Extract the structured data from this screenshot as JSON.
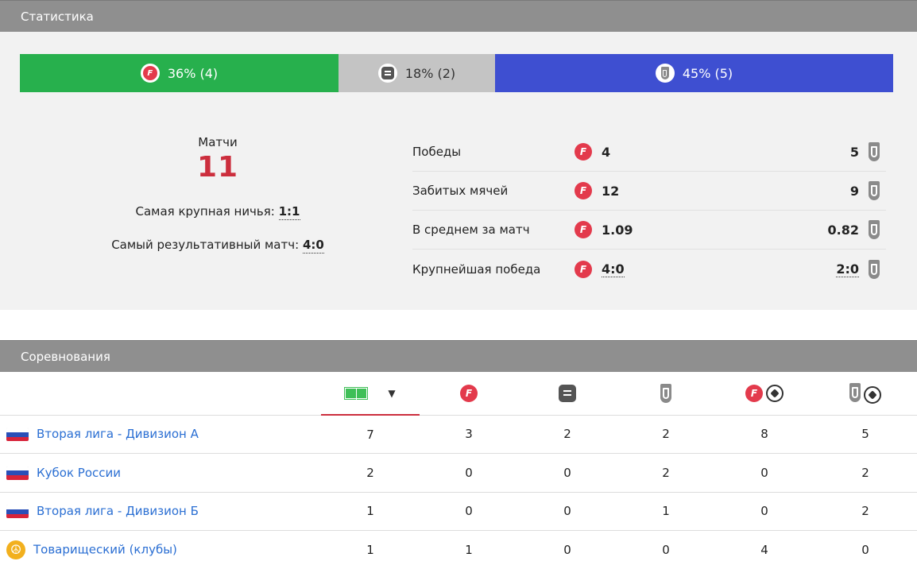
{
  "stats": {
    "title": "Статистика",
    "bar": {
      "home": {
        "text": "36% (4)",
        "fraction": 0.36,
        "color": "#27b04d"
      },
      "draw": {
        "text": "18% (2)",
        "fraction": 0.18,
        "color": "#c4c4c4"
      },
      "away": {
        "text": "45% (5)",
        "fraction": 0.45,
        "color": "#3e4fd1"
      }
    },
    "matches_label": "Матчи",
    "matches_value": "11",
    "biggest_draw_label": "Самая крупная ничья:",
    "biggest_draw_value": "1:1",
    "most_goals_label": "Самый результативный матч:",
    "most_goals_value": "4:0",
    "rows": [
      {
        "label": "Победы",
        "home": "4",
        "away": "5"
      },
      {
        "label": "Забитых мячей",
        "home": "12",
        "away": "9"
      },
      {
        "label": "В среднем за матч",
        "home": "1.09",
        "away": "0.82"
      },
      {
        "label": "Крупнейшая победа",
        "home": "4:0",
        "away": "2:0"
      }
    ]
  },
  "competitions": {
    "title": "Соревнования",
    "columns": [
      "matches-icon",
      "home-wins-icon",
      "draws-icon",
      "away-wins-icon",
      "home-goals-icon",
      "away-goals-icon"
    ],
    "rows": [
      {
        "flag": "russia",
        "name": "Вторая лига - Дивизион А",
        "values": [
          "7",
          "3",
          "2",
          "2",
          "8",
          "5"
        ]
      },
      {
        "flag": "russia",
        "name": "Кубок России",
        "values": [
          "2",
          "0",
          "0",
          "2",
          "0",
          "2"
        ]
      },
      {
        "flag": "russia",
        "name": "Вторая лига - Дивизион Б",
        "values": [
          "1",
          "0",
          "0",
          "1",
          "0",
          "2"
        ]
      },
      {
        "flag": "friendly",
        "name": "Товарищеский (клубы)",
        "values": [
          "1",
          "1",
          "0",
          "0",
          "4",
          "0"
        ]
      }
    ]
  }
}
